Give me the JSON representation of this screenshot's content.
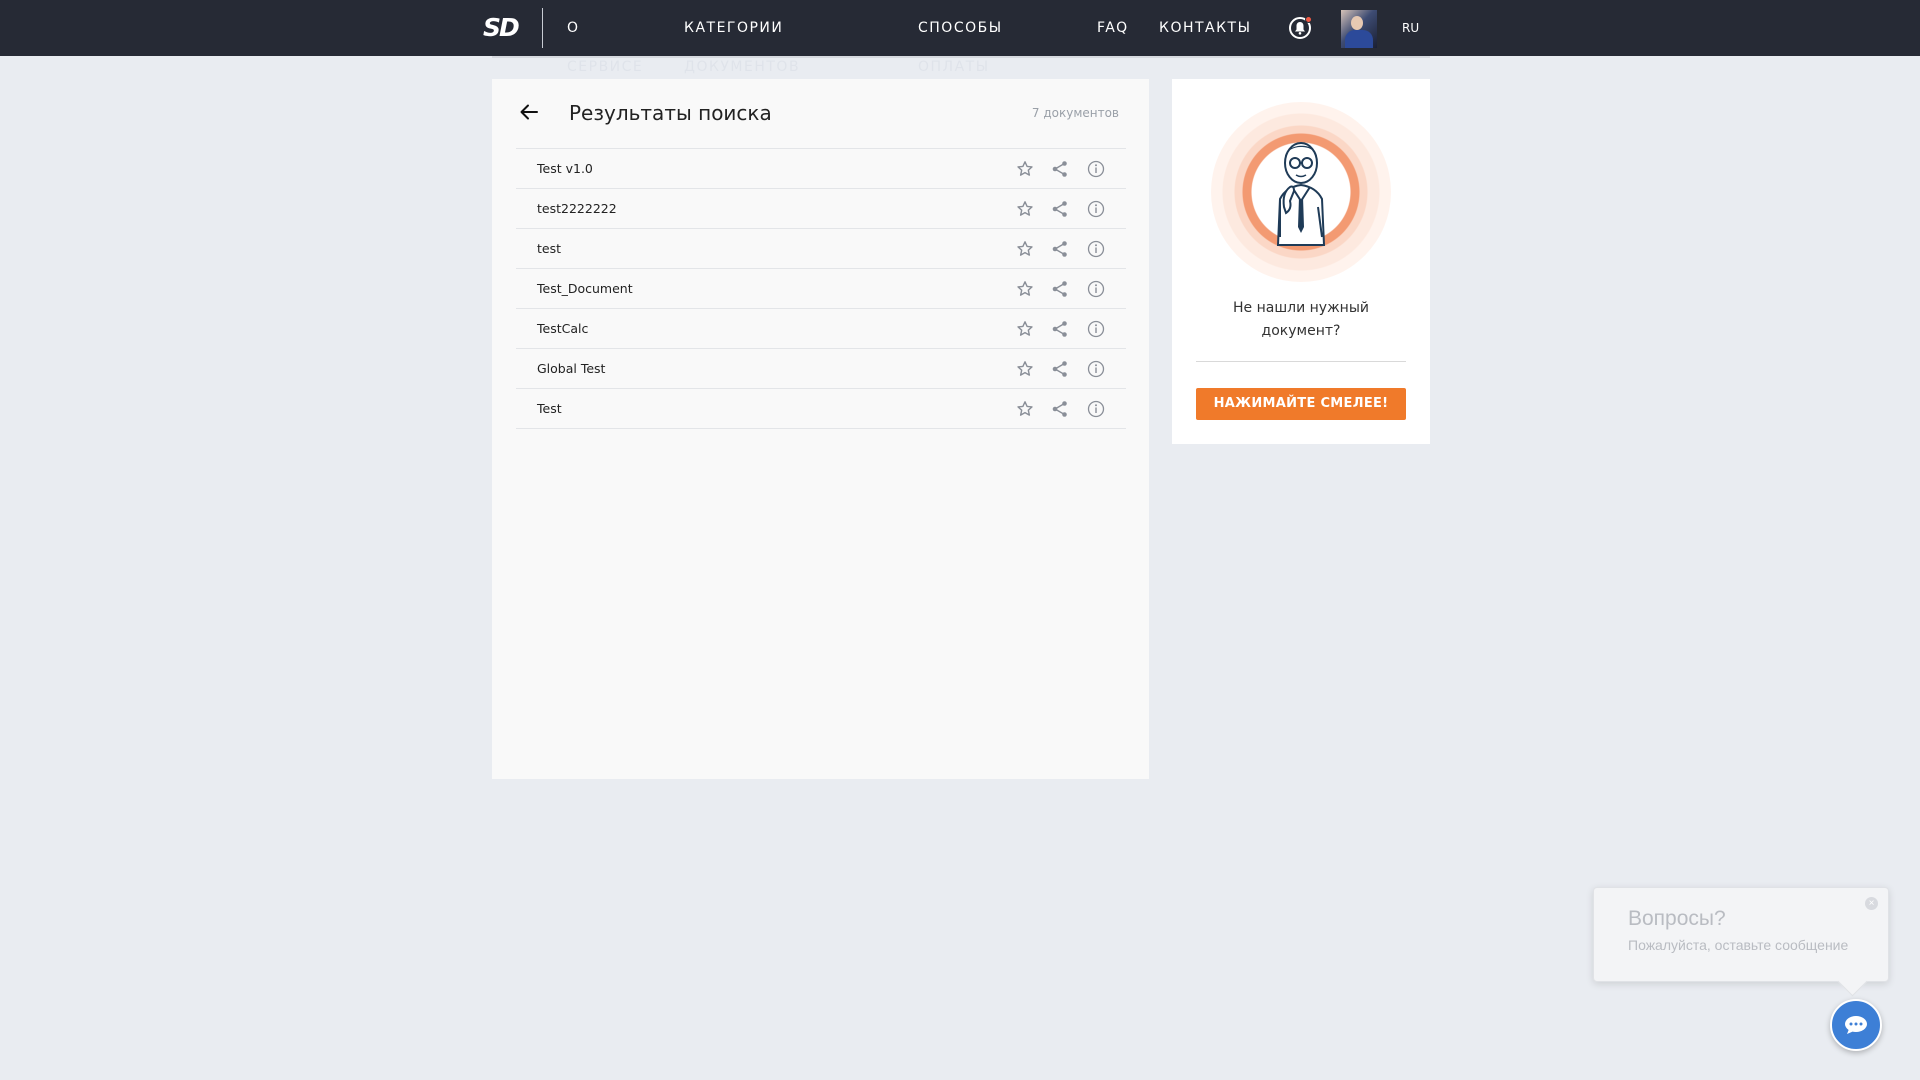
{
  "header": {
    "logo": "SD",
    "nav": [
      {
        "line1": "О",
        "line2": "СЕРВИСЕ"
      },
      {
        "line1": "КАТЕГОРИИ",
        "line2": "ДОКУМЕНТОВ"
      },
      {
        "line1": "СПОСОБЫ",
        "line2": "ОПЛАТЫ"
      },
      {
        "line1": "FAQ",
        "line2": ""
      },
      {
        "line1": "КОНТАКТЫ",
        "line2": ""
      }
    ],
    "lang": "RU"
  },
  "results": {
    "title": "Результаты поиска",
    "count": "7 документов",
    "documents": [
      {
        "name": "Test v1.0"
      },
      {
        "name": "test2222222"
      },
      {
        "name": "test"
      },
      {
        "name": "Test_Document"
      },
      {
        "name": "TestCalc"
      },
      {
        "name": "Global Test"
      },
      {
        "name": "Test"
      }
    ]
  },
  "side": {
    "text_line1": "Не нашли нужный",
    "text_line2": "документ?",
    "cta": "НАЖИМАЙТЕ СМЕЛЕЕ!"
  },
  "chat": {
    "title": "Вопросы?",
    "subtitle": "Пожалуйста, оставьте сообщение",
    "close": "×"
  },
  "colors": {
    "header_bg": "#262a35",
    "accent": "#f07a2a",
    "chat_button": "#3d7fd6",
    "notification_dot": "#ef5a45"
  }
}
